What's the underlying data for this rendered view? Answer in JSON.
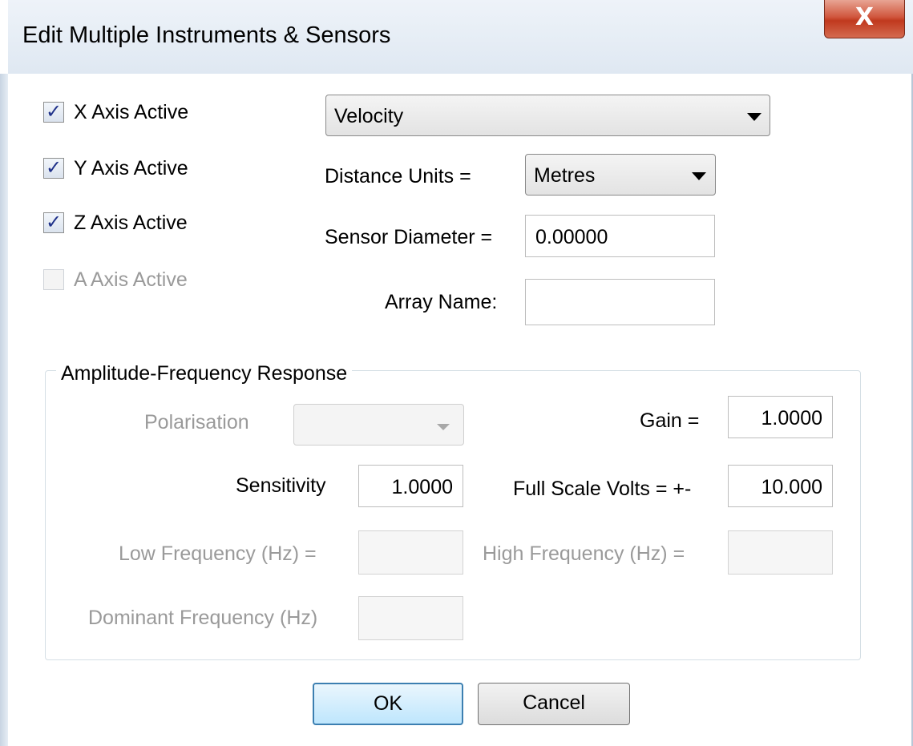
{
  "window": {
    "title": "Edit Multiple Instruments & Sensors",
    "close_glyph": "X"
  },
  "axes": [
    {
      "label": "X Axis Active",
      "checked": true,
      "enabled": true
    },
    {
      "label": "Y Axis Active",
      "checked": true,
      "enabled": true
    },
    {
      "label": "Z Axis Active",
      "checked": true,
      "enabled": true
    },
    {
      "label": "A Axis Active",
      "checked": false,
      "enabled": false
    }
  ],
  "measurement": {
    "type_selected": "Velocity",
    "distance_units_label": "Distance Units =",
    "distance_units_selected": "Metres",
    "sensor_diameter_label": "Sensor Diameter =",
    "sensor_diameter_value": "0.00000",
    "array_name_label": "Array Name:",
    "array_name_value": ""
  },
  "response": {
    "group_title": "Amplitude-Frequency Response",
    "polarisation_label": "Polarisation",
    "polarisation_selected": "",
    "gain_label": "Gain =",
    "gain_value": "1.0000",
    "sensitivity_label": "Sensitivity",
    "sensitivity_value": "1.0000",
    "full_scale_label": "Full Scale Volts = +-",
    "full_scale_value": "10.000",
    "low_freq_label": "Low Frequency (Hz) =",
    "low_freq_value": "",
    "high_freq_label": "High Frequency (Hz) =",
    "high_freq_value": "",
    "dominant_freq_label": "Dominant Frequency (Hz)",
    "dominant_freq_value": ""
  },
  "buttons": {
    "ok": "OK",
    "cancel": "Cancel"
  },
  "colors": {
    "disabled_text": "#9a9a9a",
    "checkmark": "#20328a",
    "ok_border": "#3c7fb1",
    "close_red": "#c0391e"
  },
  "icons": {
    "close": "close-icon",
    "check": "checkmark-icon",
    "dropdown": "chevron-down-icon"
  }
}
